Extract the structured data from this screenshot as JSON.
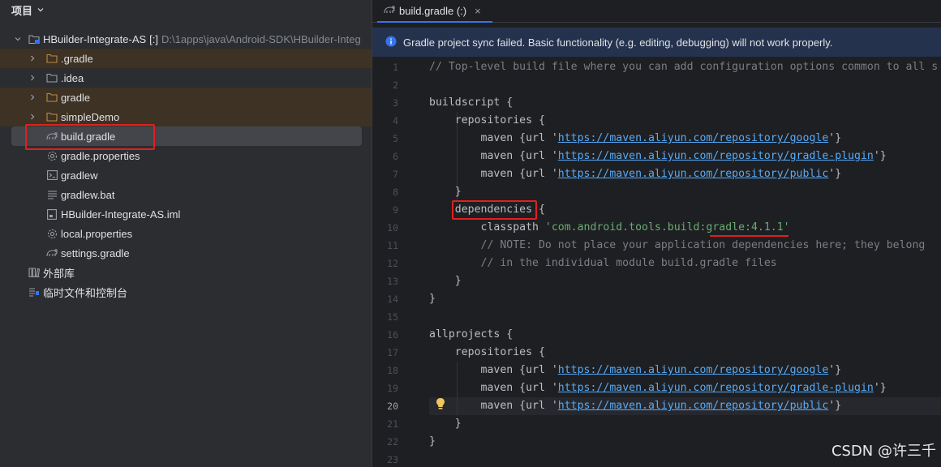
{
  "panel": {
    "title": "项目",
    "root": {
      "name": "HBuilder-Integrate-AS",
      "tag": "[:]",
      "path": "D:\\1apps\\java\\Android-SDK\\HBuilder-Integ"
    },
    "items": [
      {
        "label": ".gradle"
      },
      {
        "label": ".idea"
      },
      {
        "label": "gradle"
      },
      {
        "label": "simpleDemo"
      },
      {
        "label": "build.gradle"
      },
      {
        "label": "gradle.properties"
      },
      {
        "label": "gradlew"
      },
      {
        "label": "gradlew.bat"
      },
      {
        "label": "HBuilder-Integrate-AS.iml"
      },
      {
        "label": "local.properties"
      },
      {
        "label": "settings.gradle"
      },
      {
        "label": "外部库"
      },
      {
        "label": "临时文件和控制台"
      }
    ]
  },
  "editor": {
    "tab": {
      "label": "build.gradle (:)",
      "close": "×"
    },
    "banner": "Gradle project sync failed. Basic functionality (e.g. editing, debugging) will not work properly.",
    "line_numbers": [
      "1",
      "2",
      "3",
      "4",
      "5",
      "6",
      "7",
      "8",
      "9",
      "10",
      "11",
      "12",
      "13",
      "14",
      "15",
      "16",
      "17",
      "18",
      "19",
      "20",
      "21",
      "22",
      "23"
    ],
    "code": {
      "l1": "// Top-level build file where you can add configuration options common to all s",
      "l3": "buildscript {",
      "l4": "    repositories {",
      "maven_open": "        maven {url '",
      "maven_close_1": "'}",
      "url_google": "https://maven.aliyun.com/repository/google",
      "url_plugin": "https://maven.aliyun.com/repository/gradle-plugin",
      "url_public": "https://maven.aliyun.com/repository/public",
      "l8": "    }",
      "l9_indent": "    ",
      "l9_kw": "dependencies",
      "l9_rest": " {",
      "l10_a": "        classpath ",
      "l10_b": "'com.android.tools.build:gradle:4.1.1'",
      "l11": "        // NOTE: Do not place your application dependencies here; they belong",
      "l12": "        // in the individual module build.gradle files",
      "l13": "    }",
      "l14": "}",
      "l16": "allprojects {",
      "l17": "    repositories {",
      "l21": "    }",
      "l22": "}"
    }
  },
  "watermark": "CSDN @许三千",
  "colors": {
    "accent": "#3574f0",
    "annotation_red": "#e02020",
    "string": "#6aab73",
    "link": "#57aaf7",
    "comment": "#7a7e85"
  }
}
